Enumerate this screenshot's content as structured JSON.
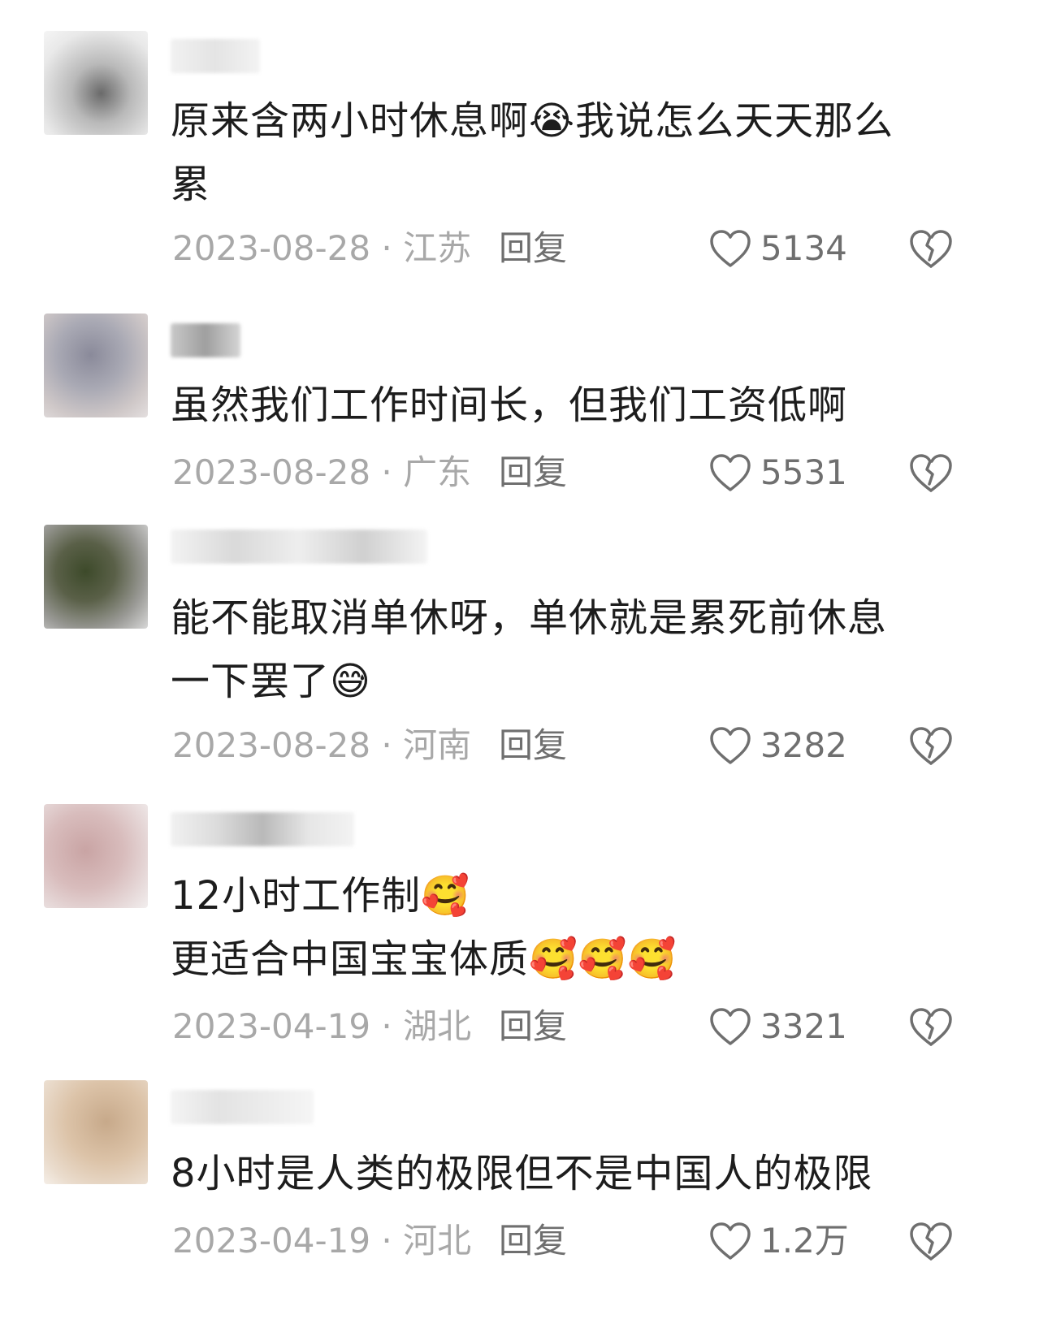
{
  "comments": [
    {
      "lines": [
        "原来含两小时休息啊😭我说怎么天天那么",
        "累"
      ],
      "date": "2023-08-28 · 江苏",
      "reply": "回复",
      "likes": "5134"
    },
    {
      "lines": [
        "虽然我们工作时间长，但我们工资低啊"
      ],
      "date": "2023-08-28 · 广东",
      "reply": "回复",
      "likes": "5531"
    },
    {
      "lines": [
        "能不能取消单休呀，单休就是累死前休息",
        "一下罢了😅"
      ],
      "date": "2023-08-28 · 河南",
      "reply": "回复",
      "likes": "3282"
    },
    {
      "lines": [
        "12小时工作制🥰",
        "更适合中国宝宝体质🥰🥰🥰"
      ],
      "date": "2023-04-19 · 湖北",
      "reply": "回复",
      "likes": "3321"
    },
    {
      "lines": [
        "8小时是人类的极限但不是中国人的极限"
      ],
      "date": "2023-04-19 · 河北",
      "reply": "回复",
      "likes": "1.2万"
    }
  ],
  "icons": {
    "like": "heart-outline-icon",
    "dislike": "broken-heart-icon"
  },
  "colors": {
    "text": "#1d1d1d",
    "meta": "#a8a8a8",
    "action": "#6f6f6f"
  }
}
